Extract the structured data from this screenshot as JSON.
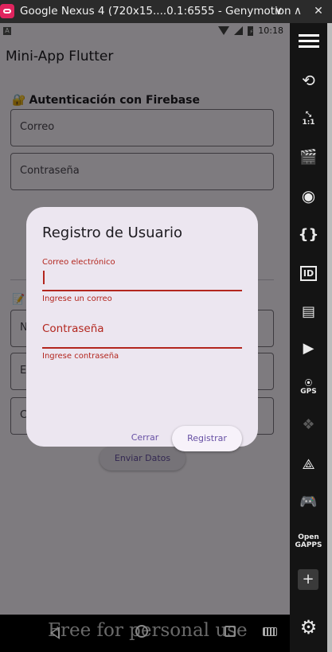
{
  "window": {
    "title": "Google Nexus 4 (720x15....0.1:6555 - Genymotion",
    "controls": [
      "∨",
      "∧",
      "✕"
    ]
  },
  "statusbar": {
    "notification": "A",
    "clock": "10:18"
  },
  "app": {
    "title": "Mini-App Flutter",
    "auth_section": {
      "icon": "🔐",
      "title": "Autenticación con Firebase"
    },
    "email_placeholder": "Correo",
    "password_placeholder": "Contraseña",
    "data_section_icon": "📝",
    "field_hints": [
      "N",
      "E",
      "C"
    ],
    "send_button": "Enviar Datos"
  },
  "dialog": {
    "title": "Registro de Usuario",
    "email_label": "Correo electrónico",
    "email_value": "",
    "email_error": "Ingrese un correo",
    "password_label": "Contraseña",
    "password_error": "Ingrese contraseña",
    "cancel": "Cerrar",
    "register": "Registrar"
  },
  "watermark": "Free for personal use",
  "toolbar": {
    "icons": [
      "menu-icon",
      "rotate-icon",
      "fullscreen-icon",
      "clapper-icon",
      "cast-icon",
      "braces-icon",
      "id-icon",
      "sd-card-icon",
      "video-icon",
      "gps-icon",
      "fingerprint-icon",
      "3d-icon",
      "gamepad-icon",
      "opengapps-icon",
      "plus-icon",
      "gear-icon"
    ],
    "scale_label": "1:1",
    "id_label": "ID",
    "gps_label": "GPS",
    "gapps_label": [
      "Open",
      "GAPPS"
    ]
  },
  "colors": {
    "error": "#b3261e",
    "primary": "#6750a4",
    "dialog_bg": "#ece6f0"
  }
}
